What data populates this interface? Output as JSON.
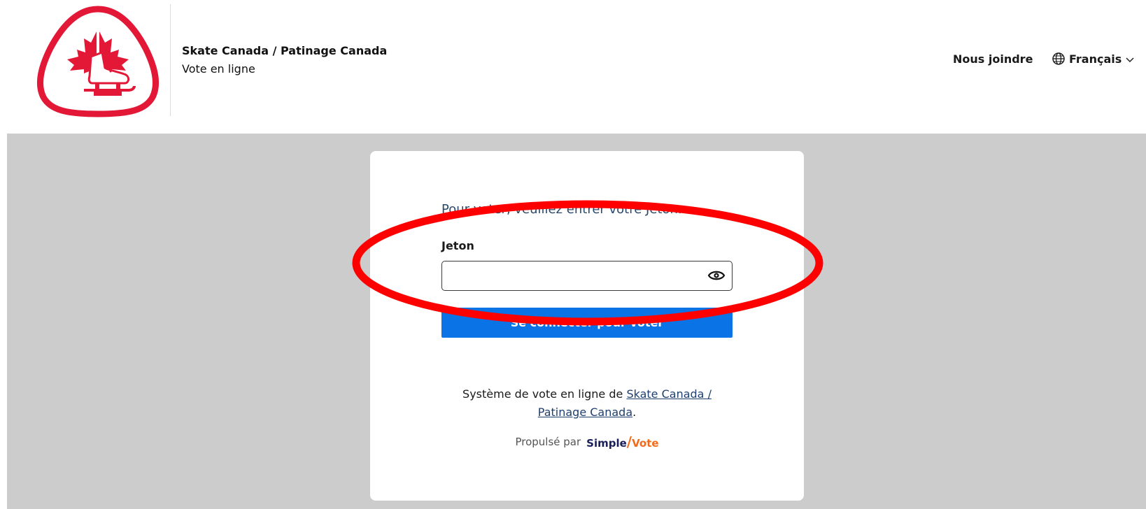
{
  "header": {
    "org_name": "Skate Canada / Patinage Canada",
    "org_subtitle": "Vote en ligne",
    "contact_label": "Nous joindre",
    "language_label": "Français",
    "logo_icon": "skate-canada-logo-icon",
    "globe_icon": "globe-icon",
    "chevron_icon": "chevron-down-icon"
  },
  "login": {
    "prompt": "Pour voter, veuillez entrer votre Jeton.",
    "field_label": "Jeton",
    "token_value": "",
    "token_placeholder": "",
    "eye_icon": "eye-icon",
    "submit_label": "Se connecter pour voter"
  },
  "footer": {
    "text_before": "Système de vote en ligne de ",
    "link_text": "Skate Canada / Patinage Canada",
    "text_after": ".",
    "powered_by": "Propulsé par",
    "brand_simple": "Simple",
    "brand_vote": "Vote"
  },
  "annotation": {
    "shape": "ellipse",
    "color": "#ff0000"
  },
  "colors": {
    "brand_red": "#e31837",
    "button_blue": "#0a73e6",
    "background_gray": "#cccccc",
    "prompt_blue": "#2b4a6b"
  }
}
